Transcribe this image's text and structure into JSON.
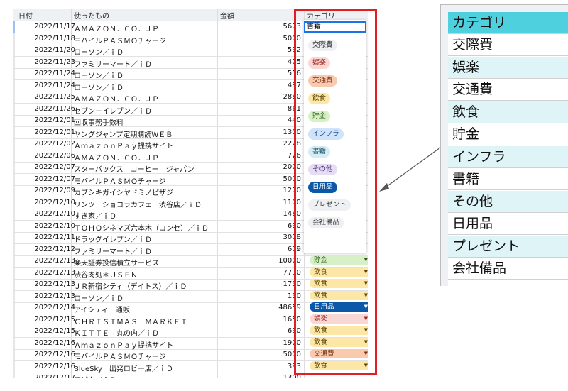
{
  "sheet": {
    "headers": [
      "日付",
      "使ったもの",
      "金額",
      "カテゴリ"
    ],
    "rows": [
      {
        "date": "2022/11/17",
        "name": "ＡＭＡＺＯＮ．ＣＯ．ＪＰ",
        "amount": "5673",
        "cat": ""
      },
      {
        "date": "2022/11/18",
        "name": "モバイルＰＡＳＭＯチャージ",
        "amount": "5000",
        "cat": ""
      },
      {
        "date": "2022/11/20",
        "name": "ローソン／ｉＤ",
        "amount": "592",
        "cat": ""
      },
      {
        "date": "2022/11/23",
        "name": "ファミリーマート／ｉＤ",
        "amount": "475",
        "cat": ""
      },
      {
        "date": "2022/11/24",
        "name": "ローソン／ｉＤ",
        "amount": "556",
        "cat": ""
      },
      {
        "date": "2022/11/24",
        "name": "ローソン／ｉＤ",
        "amount": "487",
        "cat": ""
      },
      {
        "date": "2022/11/25",
        "name": "ＡＭＡＺＯＮ．ＣＯ．ＪＰ",
        "amount": "2880",
        "cat": ""
      },
      {
        "date": "2022/11/26",
        "name": "セブン－イレブン／ｉＤ",
        "amount": "861",
        "cat": ""
      },
      {
        "date": "2022/12/01",
        "name": "回収事務手数料",
        "amount": "440",
        "cat": ""
      },
      {
        "date": "2022/12/01",
        "name": "ヤングジャンプ定期購読ＷＥＢ",
        "amount": "1300",
        "cat": ""
      },
      {
        "date": "2022/12/02",
        "name": "ＡｍａｚｏｎＰａｙ提携サイト",
        "amount": "2228",
        "cat": ""
      },
      {
        "date": "2022/12/06",
        "name": "ＡＭＡＺＯＮ．ＣＯ．ＪＰ",
        "amount": "726",
        "cat": ""
      },
      {
        "date": "2022/12/07",
        "name": "スターバックス　コーヒー　ジャパン",
        "amount": "2000",
        "cat": ""
      },
      {
        "date": "2022/12/07",
        "name": "モバイルＰＡＳＭＯチャージ",
        "amount": "5000",
        "cat": ""
      },
      {
        "date": "2022/12/09",
        "name": "カブシキガイシヤドミノピザジ",
        "amount": "1270",
        "cat": ""
      },
      {
        "date": "2022/12/10",
        "name": "リンツ　ショコラカフェ　渋谷店／ｉＤ",
        "amount": "1100",
        "cat": ""
      },
      {
        "date": "2022/12/10",
        "name": "すき家／ｉＤ",
        "amount": "1480",
        "cat": ""
      },
      {
        "date": "2022/12/10",
        "name": "ＴＯＨＯシネマズ六本木（コンセ）／ｉＤ",
        "amount": "690",
        "cat": ""
      },
      {
        "date": "2022/12/11",
        "name": "ドラッグイレブン／ｉＤ",
        "amount": "3078",
        "cat": ""
      },
      {
        "date": "2022/12/12",
        "name": "ファミリーマート／ｉＤ",
        "amount": "619",
        "cat": ""
      },
      {
        "date": "2022/12/13",
        "name": "楽天証券投信積立サービス",
        "amount": "10000",
        "cat": "貯金"
      },
      {
        "date": "2022/12/13",
        "name": "渋谷肉処＊ＵＳＥＮ",
        "amount": "7710",
        "cat": "飲食"
      },
      {
        "date": "2022/12/13",
        "name": "ＪＲ新宿シティ（デイトス）／ｉＤ",
        "amount": "1730",
        "cat": "飲食"
      },
      {
        "date": "2022/12/13",
        "name": "ローソン／ｉＤ",
        "amount": "130",
        "cat": "飲食"
      },
      {
        "date": "2022/12/14",
        "name": "アイシティ　通販",
        "amount": "48659",
        "cat": "日用品"
      },
      {
        "date": "2022/12/15",
        "name": "ＣＨＲＩＳＴＭＡＳ　ＭＡＲＫＥＴ",
        "amount": "1650",
        "cat": "娯楽"
      },
      {
        "date": "2022/12/15",
        "name": "ＫＩＴＴＥ　丸の内／ｉＤ",
        "amount": "690",
        "cat": "飲食"
      },
      {
        "date": "2022/12/16",
        "name": "ＡｍａｚｏｎＰａｙ提携サイト",
        "amount": "1900",
        "cat": "飲食"
      },
      {
        "date": "2022/12/16",
        "name": "モバイルＰＡＳＭＯチャージ",
        "amount": "5000",
        "cat": "交通費"
      },
      {
        "date": "2022/12/16",
        "name": "BlueSky　出発ロビー店／ｉＤ",
        "amount": "393",
        "cat": "飲食"
      },
      {
        "date": "2022/12/17",
        "name": "アピタ／ｉＤ",
        "amount": "1300",
        "cat": ""
      }
    ],
    "editing_value": "書籍"
  },
  "dropdown": {
    "options": [
      "交際費",
      "娯楽",
      "交通費",
      "飲食",
      "貯金",
      "インフラ",
      "書籍",
      "その他",
      "日用品",
      "プレゼント",
      "会社備品"
    ]
  },
  "zoom": {
    "header": "カテゴリ",
    "items": [
      "交際費",
      "娯楽",
      "交通費",
      "飲食",
      "貯金",
      "インフラ",
      "書籍",
      "その他",
      "日用品",
      "プレゼント",
      "会社備品"
    ]
  },
  "colors": {
    "highlight_box": "#e02020",
    "header_cyan": "#4fd0de",
    "zoom_row_tint": "#dff4f7",
    "selection_blue": "#1a73e8",
    "交際費": {
      "bg": "#eef0f3",
      "fg": "#333333"
    },
    "娯楽": {
      "bg": "#f8d7d5",
      "fg": "#9b2a22"
    },
    "交通費": {
      "bg": "#f9c9b0",
      "fg": "#7a3412"
    },
    "飲食": {
      "bg": "#fde7a6",
      "fg": "#5b4205"
    },
    "貯金": {
      "bg": "#d8f0c8",
      "fg": "#2f5d1a"
    },
    "インフラ": {
      "bg": "#cfe3fb",
      "fg": "#1c4e8a"
    },
    "書籍": {
      "bg": "#d4ecf3",
      "fg": "#275a6b"
    },
    "その他": {
      "bg": "#e6dcf4",
      "fg": "#4b2f78"
    },
    "日用品": {
      "bg": "#0b57a8",
      "fg": "#ffffff"
    },
    "プレゼント": {
      "bg": "#eef0f3",
      "fg": "#333333"
    },
    "会社備品": {
      "bg": "#eef0f3",
      "fg": "#333333"
    }
  }
}
